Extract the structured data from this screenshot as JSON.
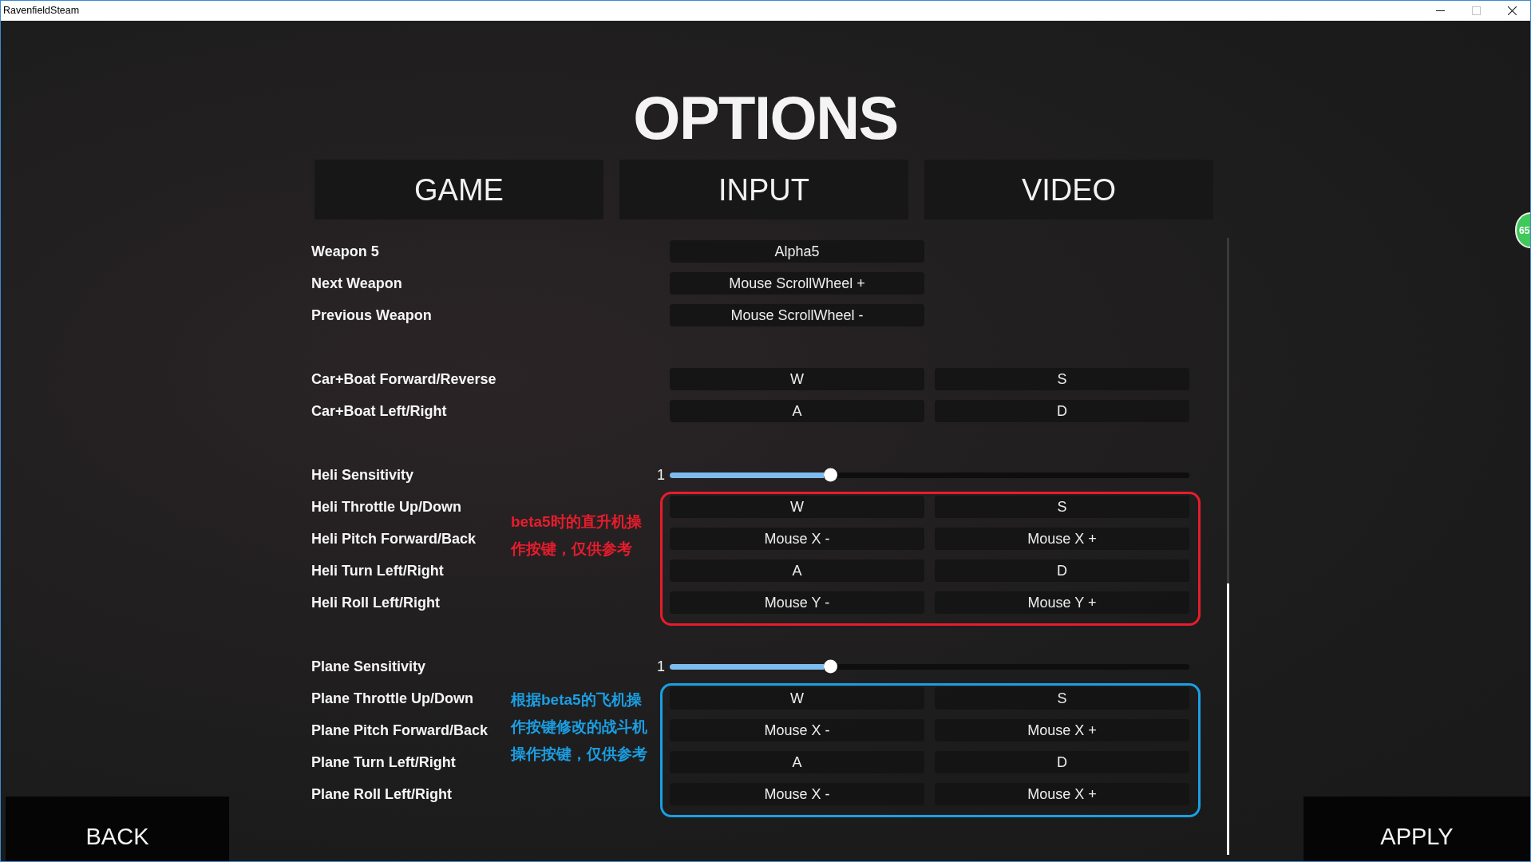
{
  "window": {
    "title": "RavenfieldSteam",
    "controls": [
      {
        "kind": "minimize",
        "disabled": false
      },
      {
        "kind": "maximize",
        "disabled": true
      },
      {
        "kind": "close",
        "disabled": false
      }
    ]
  },
  "heading": "OPTIONS",
  "tabs": [
    {
      "label": "GAME"
    },
    {
      "label": "INPUT"
    },
    {
      "label": "VIDEO"
    }
  ],
  "groups": [
    {
      "rows": [
        {
          "kind": "binding",
          "label": "Weapon 5",
          "keys": [
            "Alpha5"
          ]
        },
        {
          "kind": "binding",
          "label": "Next Weapon",
          "keys": [
            "Mouse ScrollWheel +"
          ]
        },
        {
          "kind": "binding",
          "label": "Previous Weapon",
          "keys": [
            "Mouse ScrollWheel -"
          ]
        }
      ]
    },
    {
      "rows": [
        {
          "kind": "binding",
          "label": "Car+Boat Forward/Reverse",
          "keys": [
            "W",
            "S"
          ]
        },
        {
          "kind": "binding",
          "label": "Car+Boat Left/Right",
          "keys": [
            "A",
            "D"
          ]
        }
      ]
    },
    {
      "rows": [
        {
          "kind": "slider",
          "label": "Heli Sensitivity",
          "value": "1",
          "level": 0.31
        },
        {
          "kind": "binding",
          "label": "Heli Throttle Up/Down",
          "keys": [
            "W",
            "S"
          ]
        },
        {
          "kind": "binding",
          "label": "Heli Pitch Forward/Back",
          "keys": [
            "Mouse X -",
            "Mouse X +"
          ]
        },
        {
          "kind": "binding",
          "label": "Heli Turn Left/Right",
          "keys": [
            "A",
            "D"
          ]
        },
        {
          "kind": "binding",
          "label": "Heli Roll Left/Right",
          "keys": [
            "Mouse Y -",
            "Mouse Y +"
          ]
        }
      ],
      "note": {
        "text": "beta5时的直升机操作按键，仅供参考",
        "color": "#e81c2c"
      }
    },
    {
      "rows": [
        {
          "kind": "slider",
          "label": "Plane Sensitivity",
          "value": "1",
          "level": 0.31
        },
        {
          "kind": "binding",
          "label": "Plane Throttle Up/Down",
          "keys": [
            "W",
            "S"
          ]
        },
        {
          "kind": "binding",
          "label": "Plane Pitch Forward/Back",
          "keys": [
            "Mouse X -",
            "Mouse X +"
          ]
        },
        {
          "kind": "binding",
          "label": "Plane Turn Left/Right",
          "keys": [
            "A",
            "D"
          ]
        },
        {
          "kind": "binding",
          "label": "Plane Roll Left/Right",
          "keys": [
            "Mouse X -",
            "Mouse X +"
          ]
        }
      ],
      "note": {
        "text": "根据beta5的飞机操作按键修改的战斗机操作按键，仅供参考",
        "color": "#1a9fe3"
      }
    }
  ],
  "side_indicator": {
    "text": "65"
  },
  "buttons": [
    {
      "label": "BACK"
    },
    {
      "label": "APPLY"
    }
  ]
}
